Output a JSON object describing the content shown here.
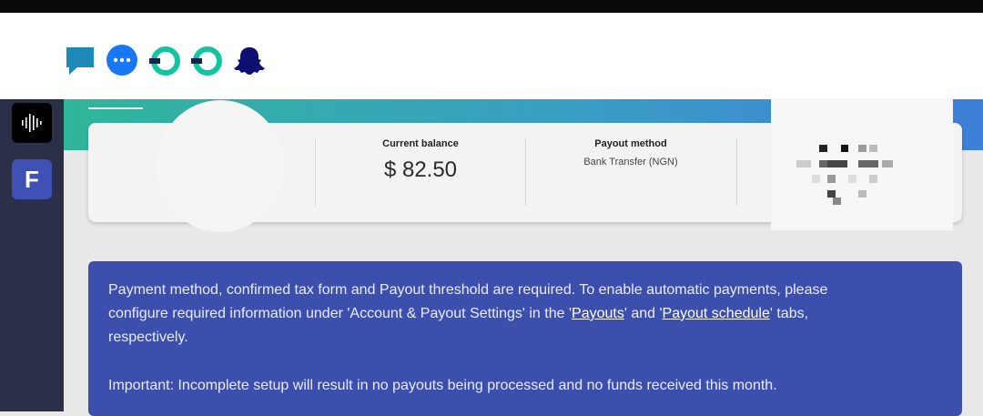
{
  "tray": {
    "icons": [
      "chat-bubble-icon",
      "messenger-icon",
      "ring-app-icon",
      "ring-app-icon",
      "snapchat-icon"
    ]
  },
  "sidebar": {
    "apps": [
      {
        "icon": "soundwave-icon"
      },
      {
        "icon": "f-app-icon",
        "letter": "F"
      }
    ]
  },
  "balance_card": {
    "current_balance_label": "Current balance",
    "current_balance_value": "$ 82.50",
    "payout_method_label": "Payout method",
    "payout_method_value": "Bank Transfer (NGN)"
  },
  "notice": {
    "line1_a": "Payment method, confirmed tax form and Payout threshold are required. To enable automatic payments, please",
    "line2_a": "configure required information under 'Account & Payout Settings' in the '",
    "payouts_link": "Payouts",
    "line2_b": "' and '",
    "payout_schedule_link": "Payout schedule",
    "line2_c": "' tabs,",
    "line3": "respectively.",
    "important": "Important: Incomplete setup will result in no payouts being processed and no funds received this month."
  },
  "colors": {
    "notice_bg": "#3d4fad",
    "sidebar_bg": "#2b2f47",
    "banner_start": "#2fb59a",
    "banner_end": "#3d7fd8",
    "f_app": "#3f51b5"
  }
}
